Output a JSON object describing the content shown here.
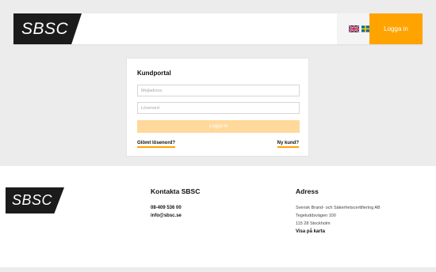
{
  "brand": {
    "logo_text": "SBSC"
  },
  "header": {
    "login_button": "Logga in",
    "languages": [
      "en-flag-icon",
      "sv-flag-icon"
    ]
  },
  "login": {
    "title": "Kundportal",
    "email_placeholder": "Mejladress",
    "password_placeholder": "Lösenord",
    "submit_label": "Logga in",
    "forgot_link": "Glömt lösenord?",
    "new_customer_link": "Ny kund?"
  },
  "footer": {
    "contact": {
      "heading": "Kontakta SBSC",
      "phone": "08-409 536 00",
      "email": "info@sbsc.se"
    },
    "address": {
      "heading": "Adress",
      "company": "Svensk Brand- och Säkerhetscertifiering AB",
      "street": "Tegeluddsvägen 100",
      "city": "115 28 Stockholm",
      "map_link": "Visa på karta"
    }
  },
  "colors": {
    "accent": "#ffa300",
    "accent_disabled": "#ffd99b",
    "logo_bg": "#1b1b1b",
    "page_bg": "#ececec"
  }
}
